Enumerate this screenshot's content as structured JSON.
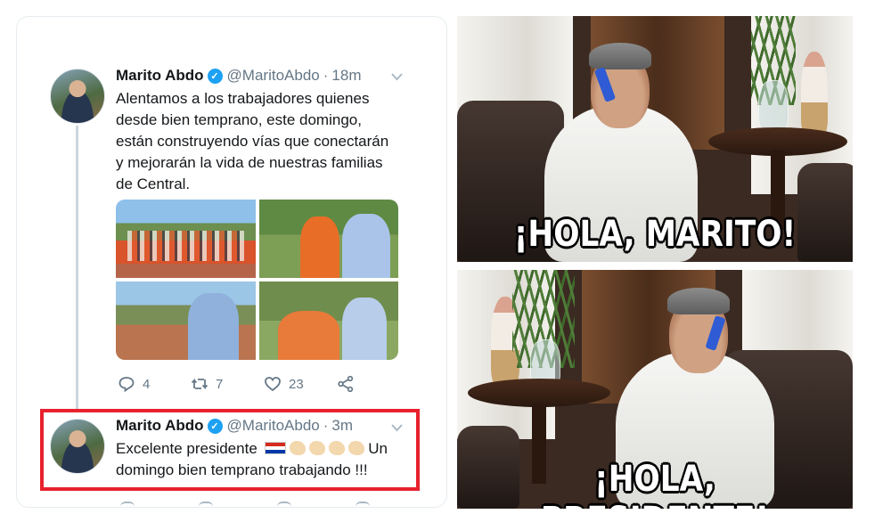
{
  "tweet": {
    "author_name": "Marito Abdo",
    "handle": "@MaritoAbdo",
    "separator": "·",
    "time": "18m",
    "verified_mark": "✓",
    "text_lines": [
      "Alentamos a los trabajadores quienes",
      "desde bien temprano, este domingo,",
      "están construyendo vías que conectarán",
      "y mejorarán la vida de nuestras familias",
      "de Central."
    ],
    "replies": "4",
    "retweets": "7",
    "likes": "23"
  },
  "reply": {
    "author_name": "Marito Abdo",
    "handle": "@MaritoAbdo",
    "separator": "·",
    "time": "3m",
    "verified_mark": "✓",
    "text_line1_start": "Excelente presidente",
    "text_line1_end": "Un",
    "text_line2": "domingo bien temprano trabajando !!!",
    "highlight_color": "#e8212e"
  },
  "memes": {
    "top_caption": "¡HOLA, MARITO!",
    "bottom_caption": "¡HOLA, PRESIDENTE!"
  },
  "icons": {
    "reply": "reply-icon",
    "retweet": "retweet-icon",
    "like": "heart-icon",
    "share": "share-icon",
    "chevron": "chevron-down-icon"
  },
  "colors": {
    "twitter_blue": "#1da1f2",
    "muted_text": "#657786",
    "highlight_red": "#e8212e"
  }
}
